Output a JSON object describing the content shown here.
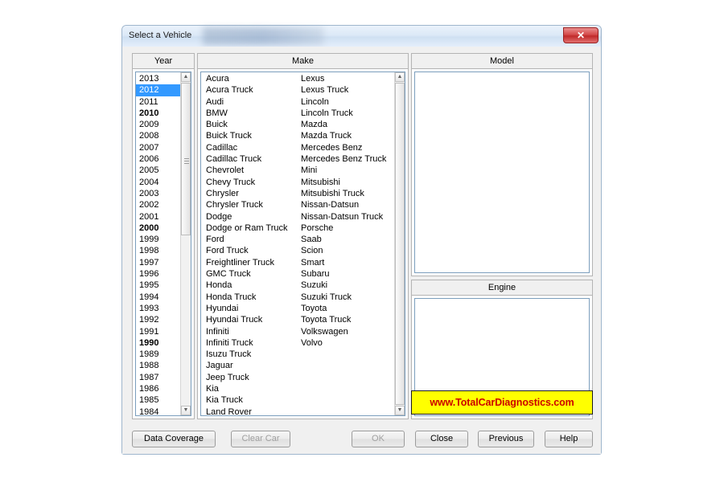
{
  "window": {
    "title": "Select a Vehicle",
    "close_icon": "✕"
  },
  "groups": {
    "year": "Year",
    "make": "Make",
    "model": "Model",
    "engine": "Engine"
  },
  "years": [
    {
      "label": "2013",
      "bold": false,
      "selected": false
    },
    {
      "label": "2012",
      "bold": false,
      "selected": true
    },
    {
      "label": "2011",
      "bold": false,
      "selected": false
    },
    {
      "label": "2010",
      "bold": true,
      "selected": false
    },
    {
      "label": "2009",
      "bold": false,
      "selected": false
    },
    {
      "label": "2008",
      "bold": false,
      "selected": false
    },
    {
      "label": "2007",
      "bold": false,
      "selected": false
    },
    {
      "label": "2006",
      "bold": false,
      "selected": false
    },
    {
      "label": "2005",
      "bold": false,
      "selected": false
    },
    {
      "label": "2004",
      "bold": false,
      "selected": false
    },
    {
      "label": "2003",
      "bold": false,
      "selected": false
    },
    {
      "label": "2002",
      "bold": false,
      "selected": false
    },
    {
      "label": "2001",
      "bold": false,
      "selected": false
    },
    {
      "label": "2000",
      "bold": true,
      "selected": false
    },
    {
      "label": "1999",
      "bold": false,
      "selected": false
    },
    {
      "label": "1998",
      "bold": false,
      "selected": false
    },
    {
      "label": "1997",
      "bold": false,
      "selected": false
    },
    {
      "label": "1996",
      "bold": false,
      "selected": false
    },
    {
      "label": "1995",
      "bold": false,
      "selected": false
    },
    {
      "label": "1994",
      "bold": false,
      "selected": false
    },
    {
      "label": "1993",
      "bold": false,
      "selected": false
    },
    {
      "label": "1992",
      "bold": false,
      "selected": false
    },
    {
      "label": "1991",
      "bold": false,
      "selected": false
    },
    {
      "label": "1990",
      "bold": true,
      "selected": false
    },
    {
      "label": "1989",
      "bold": false,
      "selected": false
    },
    {
      "label": "1988",
      "bold": false,
      "selected": false
    },
    {
      "label": "1987",
      "bold": false,
      "selected": false
    },
    {
      "label": "1986",
      "bold": false,
      "selected": false
    },
    {
      "label": "1985",
      "bold": false,
      "selected": false
    },
    {
      "label": "1984",
      "bold": false,
      "selected": false
    }
  ],
  "makes_col1": [
    "Acura",
    "Acura Truck",
    "Audi",
    "BMW",
    "Buick",
    "Buick Truck",
    "Cadillac",
    "Cadillac Truck",
    "Chevrolet",
    "Chevy Truck",
    "Chrysler",
    "Chrysler Truck",
    "Dodge",
    "Dodge or Ram Truck",
    "Ford",
    "Ford Truck",
    "Freightliner Truck",
    "GMC Truck",
    "Honda",
    "Honda Truck",
    "Hyundai",
    "Hyundai Truck",
    "Infiniti",
    "Infiniti Truck",
    "Isuzu Truck",
    "Jaguar",
    "Jeep Truck",
    "Kia",
    "Kia Truck",
    "Land Rover"
  ],
  "makes_col2": [
    "Lexus",
    "Lexus Truck",
    "Lincoln",
    "Lincoln Truck",
    "Mazda",
    "Mazda Truck",
    "Mercedes Benz",
    "Mercedes Benz Truck",
    "Mini",
    "Mitsubishi",
    "Mitsubishi Truck",
    "Nissan-Datsun",
    "Nissan-Datsun Truck",
    "Porsche",
    "Saab",
    "Scion",
    "Smart",
    "Subaru",
    "Suzuki",
    "Suzuki Truck",
    "Toyota",
    "Toyota Truck",
    "Volkswagen",
    "Volvo"
  ],
  "watermark": "www.TotalCarDiagnostics.com",
  "buttons": {
    "data_coverage": "Data Coverage",
    "clear_car": "Clear Car",
    "ok": "OK",
    "close": "Close",
    "previous": "Previous",
    "help": "Help"
  },
  "scroll": {
    "up_icon": "▲",
    "down_icon": "▼"
  },
  "colors": {
    "selection": "#3399ff",
    "watermark_bg": "#ffff00",
    "watermark_text": "#cc0000",
    "close_button": "#c02a2a"
  }
}
